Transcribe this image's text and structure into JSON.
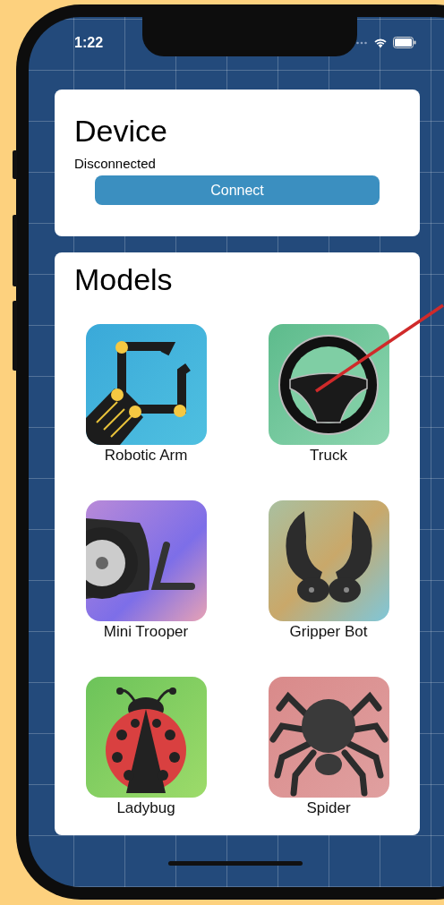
{
  "status_bar": {
    "time": "1:22"
  },
  "device": {
    "title": "Device",
    "status": "Disconnected",
    "button": "Connect"
  },
  "models": {
    "title": "Models",
    "items": [
      {
        "name": "Robotic Arm"
      },
      {
        "name": "Truck"
      },
      {
        "name": "Mini Trooper"
      },
      {
        "name": "Gripper Bot"
      },
      {
        "name": "Ladybug"
      },
      {
        "name": "Spider"
      }
    ]
  }
}
